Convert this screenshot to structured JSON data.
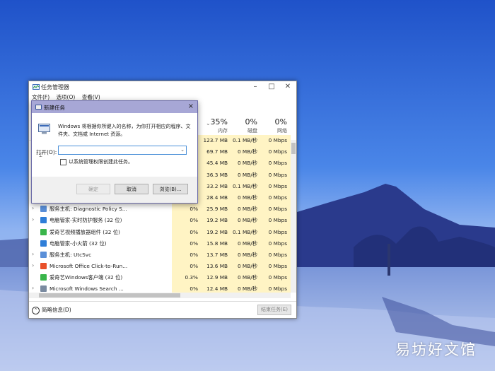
{
  "watermark": "易坊好文馆",
  "task_manager": {
    "title": "任务管理器",
    "menu": [
      "文件(F)",
      "选项(O)",
      "查看(V)"
    ],
    "columns": [
      {
        "percent": "35%",
        "label": "内存"
      },
      {
        "percent": "0%",
        "label": "磁盘"
      },
      {
        "percent": "0%",
        "label": "网络"
      }
    ],
    "rows": [
      {
        "name": "",
        "cpu": "",
        "mem": "123.7 MB",
        "disk": "0.1 MB/秒",
        "net": "0 Mbps",
        "expand": false,
        "icon_color": "#ffffff"
      },
      {
        "name": "",
        "cpu": "",
        "mem": "69.7 MB",
        "disk": "0 MB/秒",
        "net": "0 Mbps",
        "expand": false,
        "icon_color": "#ffffff"
      },
      {
        "name": "",
        "cpu": "",
        "mem": "45.4 MB",
        "disk": "0 MB/秒",
        "net": "0 Mbps",
        "expand": false,
        "icon_color": "#ffffff"
      },
      {
        "name": "",
        "cpu": "",
        "mem": "36.3 MB",
        "disk": "0 MB/秒",
        "net": "0 Mbps",
        "expand": false,
        "icon_color": "#ffffff"
      },
      {
        "name": "",
        "cpu": "",
        "mem": "33.2 MB",
        "disk": "0.1 MB/秒",
        "net": "0 Mbps",
        "expand": false,
        "icon_color": "#ffffff"
      },
      {
        "name": "",
        "cpu": "",
        "mem": "28.4 MB",
        "disk": "0 MB/秒",
        "net": "0 Mbps",
        "expand": false,
        "icon_color": "#ffffff"
      },
      {
        "name": "服务主机: Diagnostic Policy S...",
        "cpu": "0%",
        "mem": "25.9 MB",
        "disk": "0 MB/秒",
        "net": "0 Mbps",
        "expand": true,
        "icon_color": "#5a8fd8"
      },
      {
        "name": "电脑管家-实时防护服务 (32 位)",
        "cpu": "0%",
        "mem": "19.2 MB",
        "disk": "0 MB/秒",
        "net": "0 Mbps",
        "expand": true,
        "icon_color": "#2f7ed8"
      },
      {
        "name": "爱奇艺视频播放器组件 (32 位)",
        "cpu": "0%",
        "mem": "19.2 MB",
        "disk": "0.1 MB/秒",
        "net": "0 Mbps",
        "expand": false,
        "icon_color": "#39b54a"
      },
      {
        "name": "电脑管家-小火箭 (32 位)",
        "cpu": "0%",
        "mem": "15.8 MB",
        "disk": "0 MB/秒",
        "net": "0 Mbps",
        "expand": false,
        "icon_color": "#2f7ed8"
      },
      {
        "name": "服务主机: UtcSvc",
        "cpu": "0%",
        "mem": "13.7 MB",
        "disk": "0 MB/秒",
        "net": "0 Mbps",
        "expand": true,
        "icon_color": "#5a8fd8"
      },
      {
        "name": "Microsoft Office Click-to-Run...",
        "cpu": "0%",
        "mem": "13.6 MB",
        "disk": "0 MB/秒",
        "net": "0 Mbps",
        "expand": true,
        "icon_color": "#e8502a"
      },
      {
        "name": "爱奇艺Windows客户端 (32 位)",
        "cpu": "0.3%",
        "mem": "12.9 MB",
        "disk": "0 MB/秒",
        "net": "0 Mbps",
        "expand": false,
        "icon_color": "#39b54a"
      },
      {
        "name": "Microsoft Windows Search ...",
        "cpu": "0%",
        "mem": "12.4 MB",
        "disk": "0 MB/秒",
        "net": "0 Mbps",
        "expand": true,
        "icon_color": "#7a8aa0"
      }
    ],
    "footer": {
      "fewer_details": "简略信息(D)",
      "end_task": "结束任务(E)"
    }
  },
  "run_dialog": {
    "title": "新建任务",
    "close_glyph": "×",
    "description": "Windows 将根据你所键入的名称，为你打开相应的程序、文件夹、文档或 Internet 资源。",
    "open_label": "打开(O):",
    "input_value": "",
    "checkbox_label": "以系统管理权限创建此任务。",
    "buttons": {
      "ok": "确定",
      "cancel": "取消",
      "browse": "浏览(B)..."
    }
  },
  "colors": {
    "highlight_column": "#fff4c4",
    "dialog_title": "#a7a7d6",
    "sky_top": "#1f52c9",
    "lake": "#9fb4e6"
  }
}
